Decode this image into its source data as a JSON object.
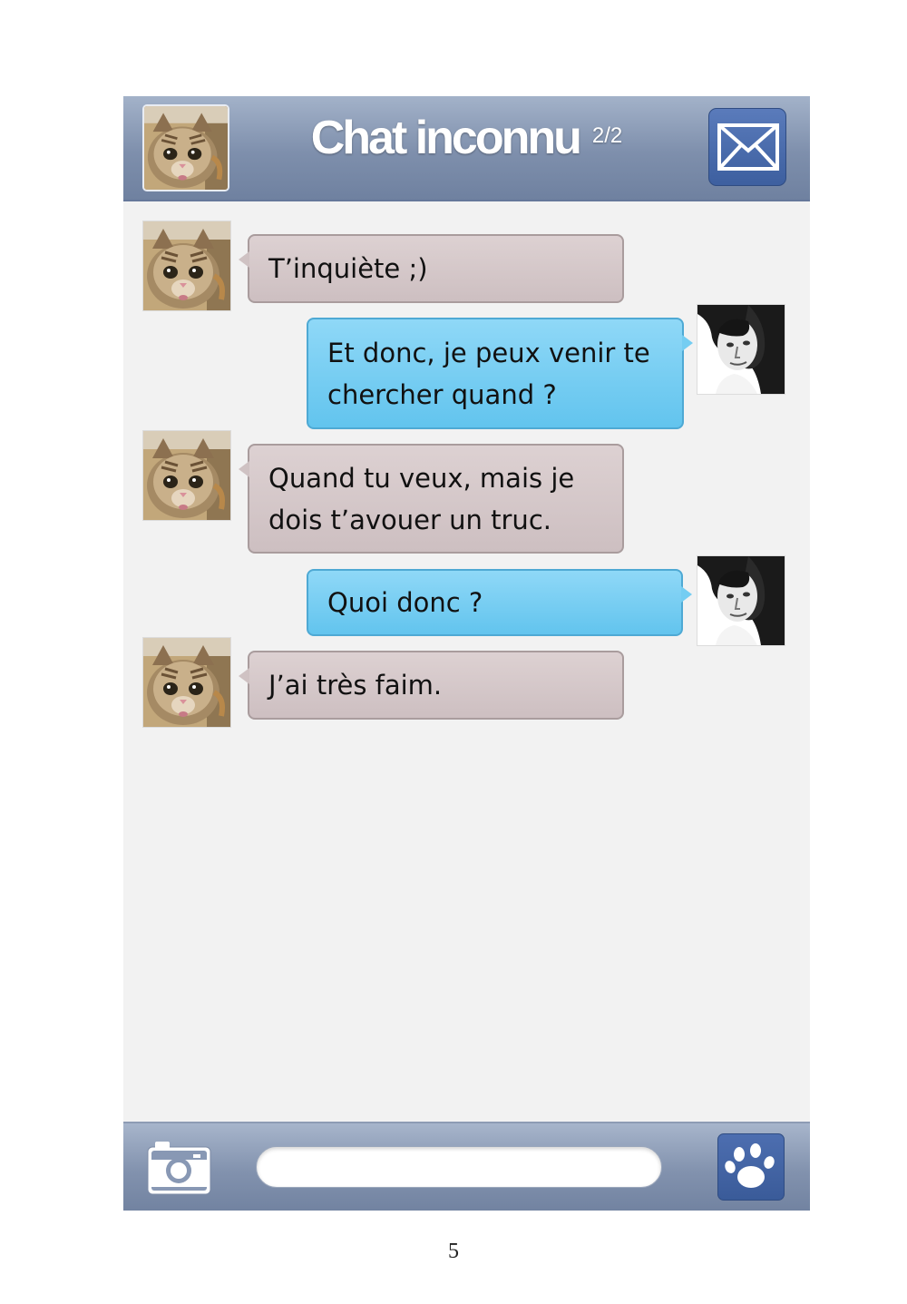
{
  "header": {
    "title": "Chat inconnu",
    "page_indicator": "2/2",
    "avatar_icon": "kitten-avatar",
    "mail_icon": "envelope-icon"
  },
  "messages": [
    {
      "sender": "kitten",
      "text": "T’inquiète ;)"
    },
    {
      "sender": "man",
      "text": "Et donc, je peux venir te chercher quand ?"
    },
    {
      "sender": "kitten",
      "text": "Quand tu veux, mais je dois t’avouer un truc."
    },
    {
      "sender": "man",
      "text": "Quoi donc ?"
    },
    {
      "sender": "kitten",
      "text": "J’ai très faim."
    }
  ],
  "footer": {
    "camera_icon": "camera-icon",
    "input_value": "",
    "paw_icon": "paw-icon"
  },
  "page_number": "5",
  "colors": {
    "header_bar": "#7e8fac",
    "incoming_bubble": "#d3c6c8",
    "outgoing_bubble": "#74cdf2",
    "action_button": "#4566a6",
    "background": "#f2f2f2"
  }
}
